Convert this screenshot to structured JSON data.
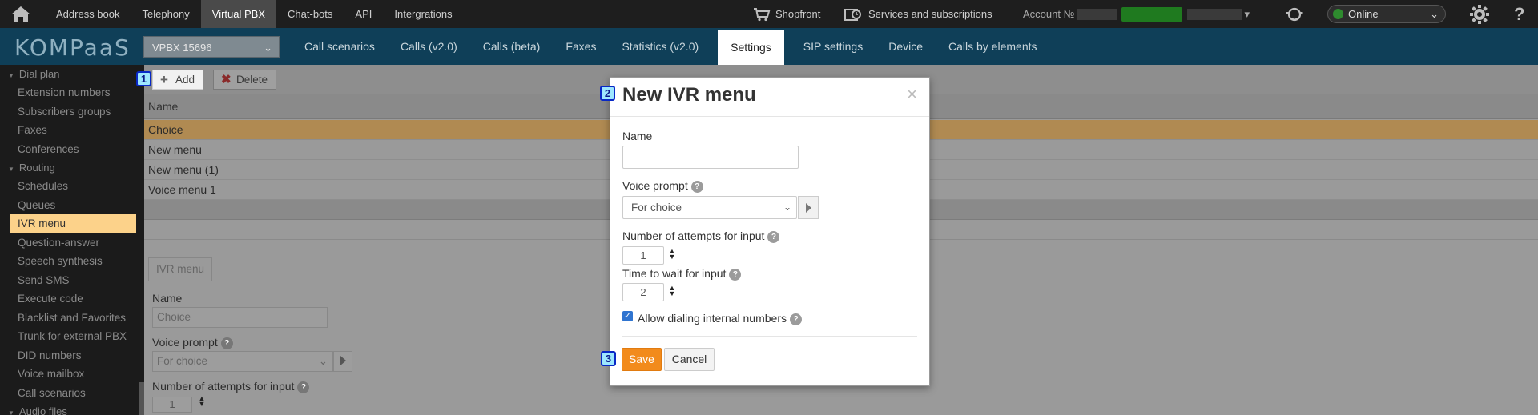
{
  "topbar": {
    "home_icon": "home-icon",
    "nav": [
      "Address book",
      "Telephony",
      "Virtual PBX",
      "Chat-bots",
      "API",
      "Intergrations"
    ],
    "active_nav": "Virtual PBX",
    "shopfront": "Shopfront",
    "services": "Services and subscriptions",
    "account_label": "Account №",
    "account_caret": "▾",
    "status": "Online",
    "help": "?"
  },
  "secondbar": {
    "logo": "KOMPaaS",
    "vpbx_select": "VPBX 15696",
    "tabs": [
      "Call scenarios",
      "Calls (v2.0)",
      "Calls (beta)",
      "Faxes",
      "Statistics (v2.0)",
      "Settings",
      "SIP settings",
      "Device",
      "Calls by elements"
    ],
    "active_tab": "Settings"
  },
  "sidebar": {
    "sections": [
      {
        "label": "Dial plan",
        "items": [
          "Extension numbers",
          "Subscribers groups",
          "Faxes",
          "Conferences"
        ]
      },
      {
        "label": "Routing",
        "items": [
          "Schedules",
          "Queues",
          "IVR menu",
          "Question-answer",
          "Speech synthesis",
          "Send SMS",
          "Execute code",
          "Blacklist and Favorites",
          "Trunk for external PBX",
          "DID numbers",
          "Voice mailbox",
          "Call scenarios"
        ]
      },
      {
        "label": "Audio files",
        "items": []
      }
    ],
    "active_item": "IVR menu"
  },
  "toolbar": {
    "add_label": "Add",
    "delete_label": "Delete"
  },
  "grid": {
    "header": "Name",
    "rows": [
      "Choice",
      "New menu",
      "New menu (1)",
      "Voice menu 1"
    ],
    "selected_row": "Choice"
  },
  "lower_panel": {
    "tab": "IVR menu",
    "name_label": "Name",
    "name_value": "Choice",
    "voice_prompt_label": "Voice prompt",
    "voice_prompt_value": "For choice",
    "attempts_label": "Number of attempts for input",
    "attempts_value": "1"
  },
  "modal": {
    "title": "New IVR menu",
    "close": "×",
    "name_label": "Name",
    "name_value": "",
    "voice_prompt_label": "Voice prompt",
    "voice_prompt_value": "For choice",
    "attempts_label": "Number of attempts for input",
    "attempts_value": "1",
    "wait_label": "Time to wait for input",
    "wait_value": "2",
    "allow_label": "Allow dialing internal numbers",
    "allow_checked": true,
    "save_label": "Save",
    "cancel_label": "Cancel"
  },
  "badges": [
    "1",
    "2",
    "3"
  ],
  "colors": {
    "topbar_bg": "#1e1e1e",
    "secondbar_bg": "#0f3f58",
    "save_orange": "#f28b1c",
    "selected_row": "#b08a52",
    "active_sidebar": "#fcd28a",
    "badge_bg": "#9ee7ff",
    "badge_border": "#0828c6",
    "status_green": "#2e8b2e"
  }
}
